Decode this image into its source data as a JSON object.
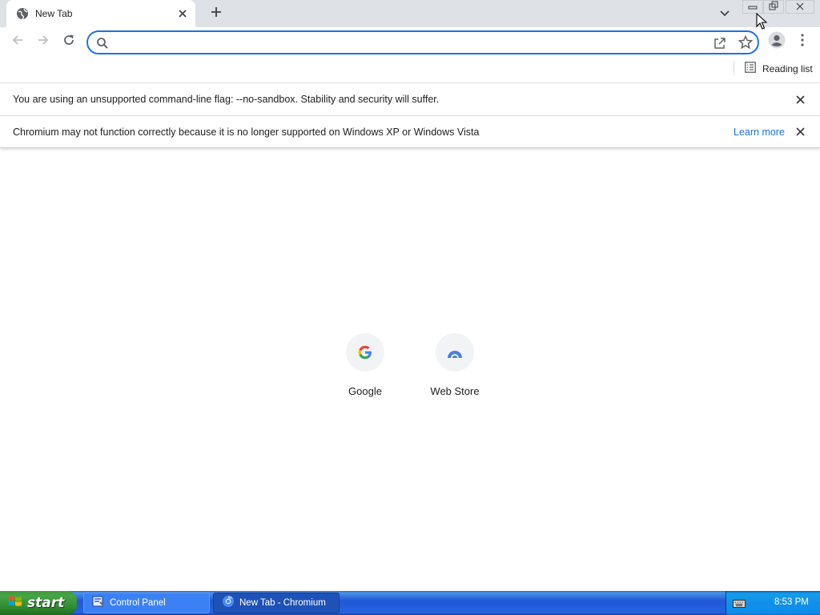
{
  "tabstrip": {
    "tab": {
      "title": "New Tab",
      "favicon": "globe-icon",
      "close_icon": "close-icon"
    },
    "new_tab_icon": "plus-icon",
    "tab_search_icon": "chevron-down-icon",
    "window_controls": [
      "minimize-icon",
      "restore-icon",
      "close-icon"
    ]
  },
  "toolbar": {
    "back_icon": "arrow-left-icon",
    "forward_icon": "arrow-right-icon",
    "reload_icon": "reload-icon",
    "omnibox": {
      "value": "",
      "placeholder": "",
      "search_icon": "search-icon",
      "share_icon": "share-icon",
      "bookmark_icon": "star-icon"
    },
    "profile_icon": "person-icon",
    "menu_icon": "kebab-menu-icon"
  },
  "bookmarks": {
    "reading_list_label": "Reading list",
    "reading_list_icon": "list-icon"
  },
  "infobars": [
    {
      "message": "You are using an unsupported command-line flag: --no-sandbox. Stability and security will suffer.",
      "link": ""
    },
    {
      "message": "Chromium may not function correctly because it is no longer supported on Windows XP or Windows Vista",
      "link": "Learn more"
    }
  ],
  "shortcuts": [
    {
      "label": "Google",
      "icon": "google-g-icon"
    },
    {
      "label": "Web Store",
      "icon": "webstore-icon"
    }
  ],
  "taskbar": {
    "start_label": "start",
    "tasks": [
      {
        "label": "Control Panel",
        "icon": "control-panel-icon",
        "active": false
      },
      {
        "label": "New Tab - Chromium",
        "icon": "chromium-icon",
        "active": true
      }
    ],
    "clock": "8:53 PM",
    "tray_icon": "keyboard-icon"
  },
  "colors": {
    "accent": "#1a73e8",
    "tabstrip_bg": "#dee1e6",
    "taskbar_blue": "#2157d7",
    "start_green": "#3c9a3c"
  }
}
